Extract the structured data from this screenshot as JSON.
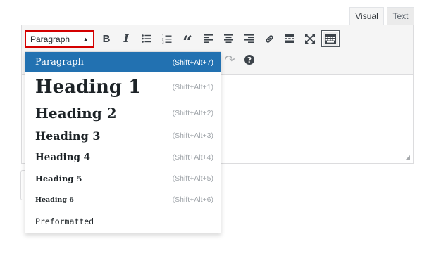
{
  "tabs": {
    "visual": "Visual",
    "text": "Text"
  },
  "toolbar": {
    "format_value": "Paragraph",
    "buttons_row1": [
      {
        "name": "bold-icon",
        "glyph": "B"
      },
      {
        "name": "italic-icon",
        "glyph": "I"
      },
      {
        "name": "bulleted-list-icon"
      },
      {
        "name": "numbered-list-icon"
      },
      {
        "name": "blockquote-icon",
        "glyph": "“"
      },
      {
        "name": "align-left-icon"
      },
      {
        "name": "align-center-icon"
      },
      {
        "name": "align-right-icon"
      },
      {
        "name": "link-icon"
      },
      {
        "name": "read-more-icon"
      },
      {
        "name": "fullscreen-icon"
      },
      {
        "name": "toolbar-toggle-icon",
        "active": true
      }
    ],
    "buttons_row2": [
      {
        "name": "redo-icon",
        "glyph": "↷"
      },
      {
        "name": "help-icon",
        "glyph": "?"
      }
    ]
  },
  "format_menu": {
    "items": [
      {
        "label": "Paragraph",
        "shortcut": "(Shift+Alt+7)",
        "selected": true
      },
      {
        "label": "Heading 1",
        "shortcut": "(Shift+Alt+1)"
      },
      {
        "label": "Heading 2",
        "shortcut": "(Shift+Alt+2)"
      },
      {
        "label": "Heading 3",
        "shortcut": "(Shift+Alt+3)"
      },
      {
        "label": "Heading 4",
        "shortcut": "(Shift+Alt+4)"
      },
      {
        "label": "Heading 5",
        "shortcut": "(Shift+Alt+5)"
      },
      {
        "label": "Heading 6",
        "shortcut": "(Shift+Alt+6)"
      },
      {
        "label": "Preformatted",
        "shortcut": ""
      }
    ]
  },
  "colors": {
    "selected_bg": "#2271b1",
    "format_select_border": "#d40000"
  }
}
